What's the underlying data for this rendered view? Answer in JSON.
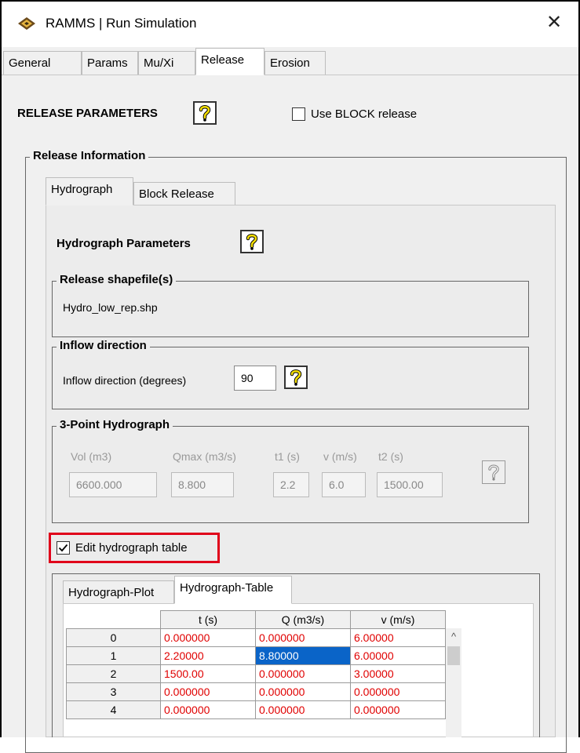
{
  "window": {
    "title": "RAMMS | Run Simulation",
    "close_glyph": "✕",
    "icon": "ramms-app-icon"
  },
  "tabs": [
    {
      "label": "General",
      "active": false
    },
    {
      "label": "Params",
      "active": false
    },
    {
      "label": "Mu/Xi",
      "active": false
    },
    {
      "label": "Release",
      "active": true
    },
    {
      "label": "Erosion",
      "active": false
    }
  ],
  "release": {
    "heading": "RELEASE PARAMETERS",
    "use_block_label": "Use BLOCK release",
    "use_block_checked": false,
    "info_legend": "Release Information"
  },
  "subtabs": [
    {
      "label": "Hydrograph",
      "active": true
    },
    {
      "label": "Block Release",
      "active": false
    }
  ],
  "hydrograph": {
    "heading": "Hydrograph Parameters",
    "shapefile_legend": "Release shapefile(s)",
    "shapefile_name": "Hydro_low_rep.shp",
    "inflow_legend": "Inflow direction",
    "inflow_label": "Inflow direction (degrees)",
    "inflow_value": "90",
    "three_point_legend": "3-Point Hydrograph",
    "fields": [
      {
        "label": "Vol (m3)",
        "value": "6600.000"
      },
      {
        "label": "Qmax (m3/s)",
        "value": "8.800"
      },
      {
        "label": "t1 (s)",
        "value": "2.2"
      },
      {
        "label": "v (m/s)",
        "value": "6.0"
      },
      {
        "label": "t2 (s)",
        "value": "1500.00"
      }
    ],
    "edit_table_label": "Edit hydrograph table",
    "edit_table_checked": true
  },
  "table_tabs": [
    {
      "label": "Hydrograph-Plot",
      "active": false
    },
    {
      "label": "Hydrograph-Table",
      "active": true
    }
  ],
  "table": {
    "columns": [
      "t (s)",
      "Q (m3/s)",
      "v (m/s)"
    ],
    "rows": [
      {
        "index": "0",
        "cells": [
          "0.000000",
          "0.000000",
          "6.00000"
        ]
      },
      {
        "index": "1",
        "cells": [
          "2.20000",
          "8.80000",
          "6.00000"
        ]
      },
      {
        "index": "2",
        "cells": [
          "1500.00",
          "0.000000",
          "3.00000"
        ]
      },
      {
        "index": "3",
        "cells": [
          "0.000000",
          "0.000000",
          "0.000000"
        ]
      },
      {
        "index": "4",
        "cells": [
          "0.000000",
          "0.000000",
          "0.000000"
        ]
      }
    ],
    "selected_cell": "1,1",
    "scroll_up_glyph": "^"
  },
  "colors": {
    "highlight_border": "#e0001a",
    "value_text": "#e00000",
    "selection": "#0a64c8"
  }
}
